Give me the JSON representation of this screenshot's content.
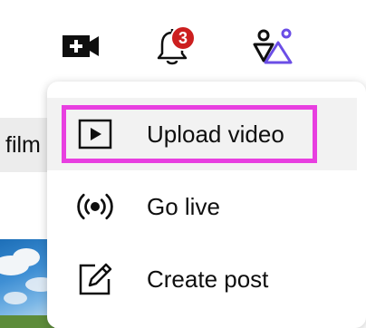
{
  "topbar": {
    "create_icon": "video-plus-icon",
    "notifications": {
      "icon": "bell-icon",
      "badge_count": "3",
      "badge_color": "#cc1f1f"
    },
    "account_icon": "youtube-studio-shapes-icon"
  },
  "background": {
    "search_chip_text": "film"
  },
  "menu": {
    "items": [
      {
        "icon": "upload-video-icon",
        "label": "Upload video"
      },
      {
        "icon": "live-broadcast-icon",
        "label": "Go live"
      },
      {
        "icon": "pencil-square-icon",
        "label": "Create post"
      }
    ]
  },
  "colors": {
    "highlight": "#e83fe0",
    "accent_purple": "#6b4ee6",
    "text": "#0f0f0f"
  }
}
